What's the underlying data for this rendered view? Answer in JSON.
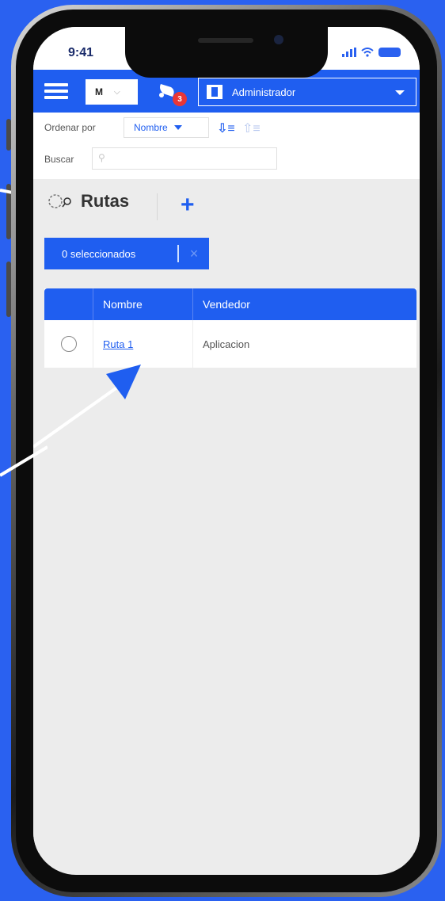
{
  "status_bar": {
    "time": "9:41"
  },
  "header": {
    "company_select": "M",
    "notifications_count": "3",
    "user_role": "Administrador"
  },
  "controls": {
    "sort_label": "Ordenar por",
    "sort_value": "Nombre",
    "search_label": "Buscar",
    "search_value": ""
  },
  "page": {
    "title": "Rutas",
    "add_symbol": "+"
  },
  "selection": {
    "count_label": "0 seleccionados",
    "clear_symbol": "×"
  },
  "table": {
    "columns": [
      "Nombre",
      "Vendedor"
    ],
    "rows": [
      {
        "nombre": "Ruta 1",
        "vendedor": "Aplicacion"
      }
    ]
  },
  "colors": {
    "background": "#2a61f0",
    "accent": "#1f5ef0",
    "badge": "#e93636"
  }
}
